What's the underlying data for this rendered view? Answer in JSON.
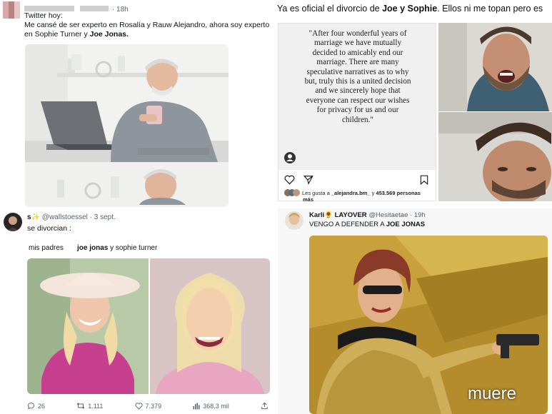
{
  "p1": {
    "time": "· 18h",
    "line1": "Twitter hoy:",
    "line2": "Me cansé de ser experto en Rosalía y Rauw Alejandro, ahora soy experto",
    "line3a": "en Sophie Turner y ",
    "line3b": "Joe Jonas."
  },
  "p2": {
    "header_a": "Ya es oficial el divorcio de ",
    "header_b": "Joe y Sophie",
    "header_c": ". Ellos ni me topan pero es",
    "quote": "\"After four wonderful years of marriage we have mutually decided to amicably end our marriage. There are many speculative narratives as to why but, truly this is a united decision and we sincerely hope that everyone can respect our wishes for privacy for us and our children.\"",
    "likes_a": "Les gusta a ",
    "likes_b": "_alejandra.bm_",
    "likes_c": " y ",
    "likes_d": "453.569 personas",
    "likes_e": "más"
  },
  "p3": {
    "handle_prefix": "s",
    "handle": "@wallstoessel · 3 sept.",
    "text": "se divorcian :",
    "label_left": "mis padres",
    "label_right_a": "joe jonas",
    "label_right_b": " y sophie turner",
    "replies": "26",
    "retweets": "1.111",
    "likes": "7.379",
    "views": "368,3 mil"
  },
  "p4": {
    "name": "Karli",
    "name_badge": "LAYOVER",
    "handle": "@Hesitaetae · 19h",
    "text_a": "VENGO A DEFENDER A ",
    "text_b": "JOE JONAS",
    "caption": "muere"
  }
}
